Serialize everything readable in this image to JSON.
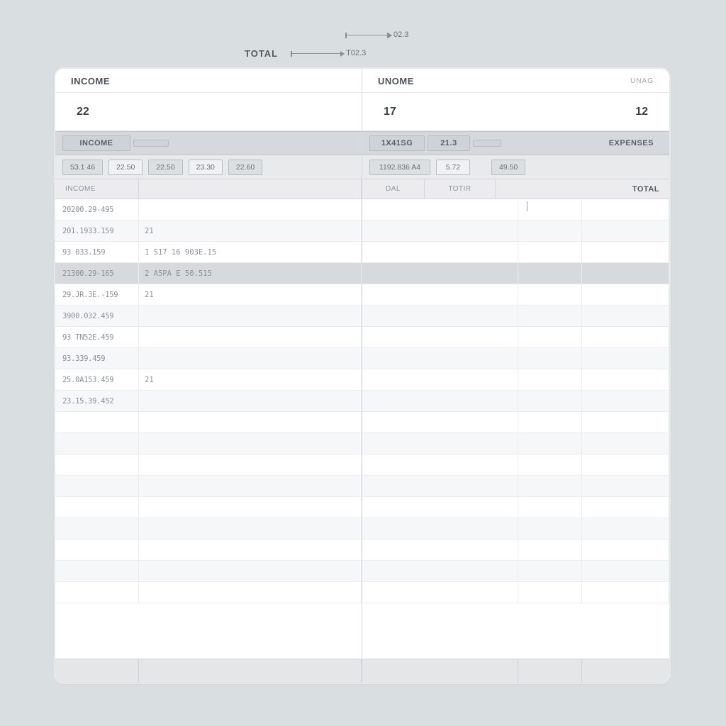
{
  "scale": {
    "total_label": "TOTAL",
    "val1": "02.3",
    "val2": "T02.3"
  },
  "left": {
    "title": "INCOME",
    "big": "22",
    "header_main": "INCOME",
    "chips": [
      "53.1 46",
      "22.50",
      "22.50",
      "23.30",
      "22.60"
    ],
    "sub1": "INCOME",
    "rows": [
      {
        "a": "20200.29-495",
        "b": ""
      },
      {
        "a": "201.1933.159",
        "b": "21"
      },
      {
        "a": "93 033.159",
        "b": "1 S17 16 903E.15"
      },
      {
        "a": "21300.29-165",
        "b": "2 A5PA E 50.515",
        "hl": true
      },
      {
        "a": "29.JR.3E.-159",
        "b": "21"
      },
      {
        "a": "3900.032.459",
        "b": ""
      },
      {
        "a": "93 TN52E.459",
        "b": ""
      },
      {
        "a": "93.339.459",
        "b": ""
      },
      {
        "a": "25.0A153.459",
        "b": "21"
      },
      {
        "a": "23.15.39.452",
        "b": ""
      }
    ]
  },
  "right": {
    "title": "UNOME",
    "title_sub": "UNAG",
    "big_a": "17",
    "big_b": "12",
    "header_a": "1X41SG",
    "header_b": "21.3",
    "header_c": "EXPENSES",
    "chips": [
      "1192.836 A4",
      "5.72",
      "49.50"
    ],
    "sub_a": "DAL",
    "sub_b": "TOTIR",
    "sub_c": "TOTAL"
  }
}
